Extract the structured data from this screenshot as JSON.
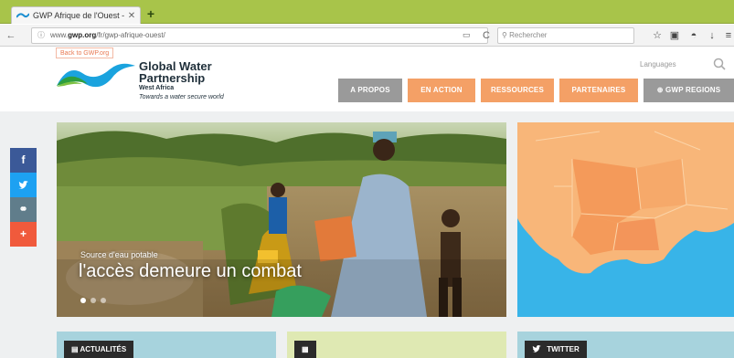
{
  "browser": {
    "tab_title": "GWP Afrique de l'Ouest - ...",
    "tab_close": "✕",
    "new_tab": "+",
    "url_prefix": "www.",
    "url_domain": "gwp.org",
    "url_path": "/fr/gwp-afrique-ouest/",
    "search_placeholder": "Rechercher"
  },
  "header": {
    "back_link": "Back to GWP.org",
    "logo_line1": "Global Water",
    "logo_line2": "Partnership",
    "logo_line3": "West Africa",
    "logo_tagline": "Towards a water secure world",
    "languages": "Languages"
  },
  "menu": [
    {
      "label": "A PROPOS"
    },
    {
      "label": "EN ACTION"
    },
    {
      "label": "RESSOURCES"
    },
    {
      "label": "PARTENAIRES"
    },
    {
      "label": "GWP REGIONS"
    }
  ],
  "hero": {
    "caption_small": "Source d'eau potable",
    "caption_big": "l'accès demeure un combat",
    "slides": 3,
    "active_slide": 1
  },
  "social": [
    {
      "glyph": "f",
      "color": "#3b5998"
    },
    {
      "glyph": "t",
      "color": "#1da1f2"
    },
    {
      "glyph": "⚭",
      "color": "#607d8b"
    },
    {
      "glyph": "+",
      "color": "#f05a3c"
    }
  ],
  "cards": [
    {
      "label": "ACTUALITÉS",
      "color": "#a7d3dd"
    },
    {
      "label": "",
      "color": "#dfe9b3"
    },
    {
      "label": "TWITTER",
      "color": "#a7d3dd"
    }
  ],
  "colors": {
    "browser_accent": "#a8c44a",
    "menu_orange": "#f4a066",
    "menu_grey": "#9a9a9a",
    "map_sea": "#38b4e8",
    "map_land": "#f8b679"
  }
}
